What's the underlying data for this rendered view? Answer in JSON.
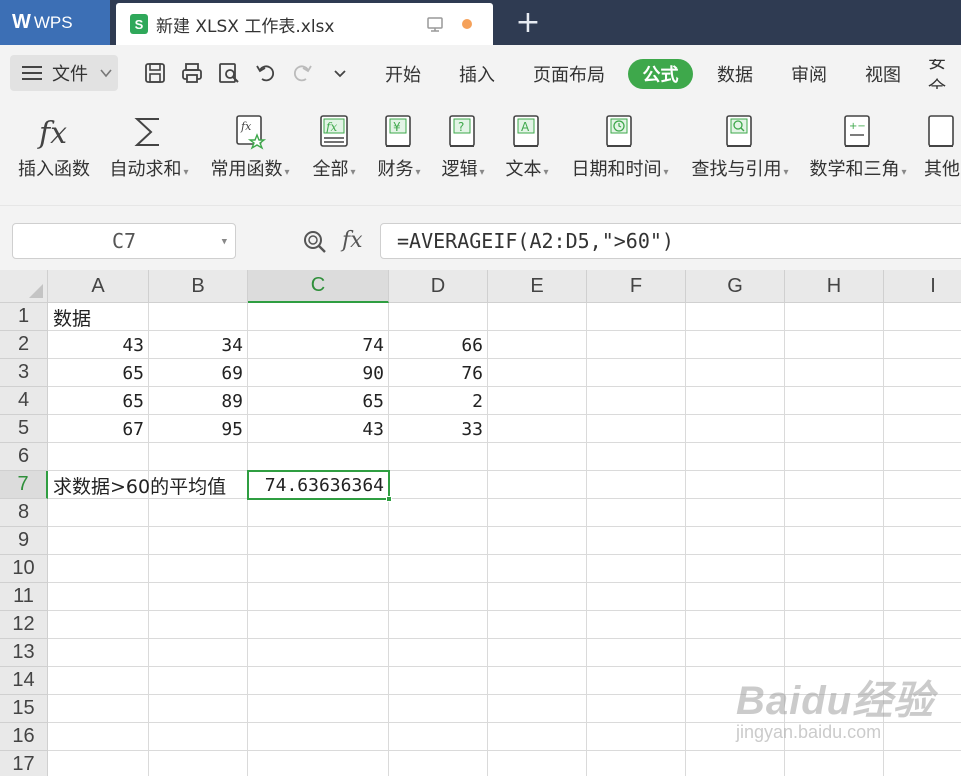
{
  "titlebar": {
    "brand": "WPS",
    "doc_tab": "新建 XLSX 工作表.xlsx",
    "new_tab": "+"
  },
  "menubar": {
    "file": "文件",
    "tabs": [
      "开始",
      "插入",
      "页面布局",
      "公式",
      "数据",
      "审阅",
      "视图",
      "安全"
    ],
    "active_tab": "公式"
  },
  "ribbon": {
    "buttons": [
      "插入函数",
      "自动求和",
      "常用函数",
      "全部",
      "财务",
      "逻辑",
      "文本",
      "日期和时间",
      "查找与引用",
      "数学和三角",
      "其他"
    ]
  },
  "formula_bar": {
    "name_box": "C7",
    "fx": "fx",
    "formula": "=AVERAGEIF(A2:D5,\">60\")"
  },
  "grid": {
    "columns": [
      "A",
      "B",
      "C",
      "D",
      "E",
      "F",
      "G",
      "H",
      "I"
    ],
    "rows": [
      "1",
      "2",
      "3",
      "4",
      "5",
      "6",
      "7",
      "8",
      "9",
      "10",
      "11",
      "12",
      "13",
      "14",
      "15",
      "16",
      "17"
    ],
    "selected_column": "C",
    "selected_row": "7",
    "cells": {
      "A1": "数据",
      "A2": "43",
      "B2": "34",
      "C2": "74",
      "D2": "66",
      "A3": "65",
      "B3": "69",
      "C3": "90",
      "D3": "76",
      "A4": "65",
      "B4": "89",
      "C4": "65",
      "D4": "2",
      "A5": "67",
      "B5": "95",
      "C5": "43",
      "D5": "33",
      "A7": "求数据>60的平均值",
      "C7": "74.63636364"
    }
  },
  "watermark": {
    "main": "Baidu经验",
    "sub": "jingyan.baidu.com"
  },
  "colors": {
    "accent_green": "#3ea84b",
    "title_bar": "#2f3b52",
    "brand_blue": "#3c6fb5"
  }
}
